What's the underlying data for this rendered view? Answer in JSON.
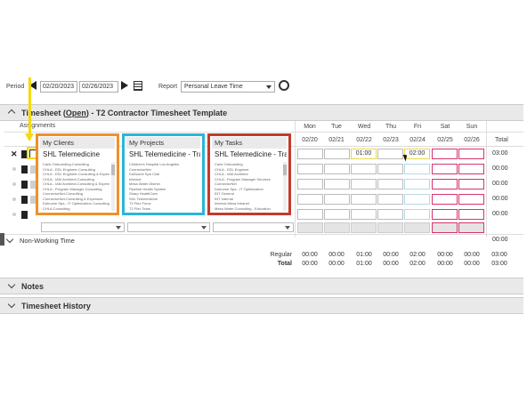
{
  "toolbar": {
    "period_label": "Period",
    "start_date": "02/20/2023",
    "end_date": "02/26/2023",
    "report_label": "Report",
    "report_value": "Personal Leave Time"
  },
  "timesheet": {
    "title_prefix": "Timesheet (",
    "title_status": "Open",
    "title_suffix": ")  - T2 Contractor Timesheet Template",
    "assignments_label": "Assignments",
    "total_label": "Total",
    "days": [
      {
        "name": "Mon",
        "date": "02/20"
      },
      {
        "name": "Tue",
        "date": "02/21"
      },
      {
        "name": "Wed",
        "date": "02/22"
      },
      {
        "name": "Thu",
        "date": "02/23"
      },
      {
        "name": "Fri",
        "date": "02/24"
      },
      {
        "name": "Sat",
        "date": "02/25"
      },
      {
        "name": "Sun",
        "date": "02/26"
      }
    ],
    "row1": {
      "wed": "01:00",
      "fri": "02:00"
    },
    "row_totals": [
      "03:00",
      "00:00",
      "00:00",
      "00:00",
      "00:00"
    ],
    "clients": {
      "title": "My Clients",
      "selected": "SHL Telemedicine",
      "items": [
        "Carle Onboarding-Consulting",
        "CHLA - EDL Engineer-Consulting",
        "CHLA - EDL Engineer-Consulting & Expense",
        "CHLA - IAM Architect-Consulting",
        "CHLA - IAM Architect-Consulting & Expense",
        "CHLA - Program Manager-Consulting",
        "ConnectorNet-Consulting",
        "ConnectorNet-Consulting & Expenses",
        "Dubuone Spa - IT Optimization Consulting",
        "CHLA Consulting"
      ]
    },
    "projects": {
      "title": "My Projects",
      "selected": "SHL Telemedicine - Traini",
      "items": [
        "Children's Hospital Los Angeles",
        "ConnectorNet",
        "DuBuone Spa Club",
        "Internal",
        "Mesa Water District",
        "Pipeline Health System",
        "Sharp HealthCare",
        "SHL Telemedicine",
        "T2 Flex Force",
        "T2 Flex Team"
      ]
    },
    "tasks": {
      "title": "My Tasks",
      "selected": "SHL Telemedicine - Traini",
      "items": [
        "Carle Onboarding",
        "CHLA - EDL Engineer",
        "CHLA - IAM Architect",
        "CHLA - Program Manager Services",
        "ConnectorNet",
        "Dubuone Spa - IT Optimization",
        "INT General",
        "INT Internal",
        "Internal Mesa Intranet",
        "Mesa Water Consulting - Education"
      ]
    }
  },
  "non_working": {
    "title": "Non-Working Time",
    "total": "00:00"
  },
  "summary": {
    "regular_label": "Regular",
    "total_label": "Total",
    "regular": [
      "00:00",
      "00:00",
      "01:00",
      "00:00",
      "02:00",
      "00:00",
      "00:00",
      "03:00"
    ],
    "total": [
      "00:00",
      "00:00",
      "01:00",
      "00:00",
      "02:00",
      "00:00",
      "00:00",
      "03:00"
    ]
  },
  "sections": {
    "notes": "Notes",
    "history": "Timesheet History"
  },
  "colors": {
    "clients_border": "#f0902c",
    "projects_border": "#2bb5d8",
    "tasks_border": "#c23a2b",
    "weekend_border": "#d6336c",
    "highlight_arrow": "#f5d90a"
  }
}
